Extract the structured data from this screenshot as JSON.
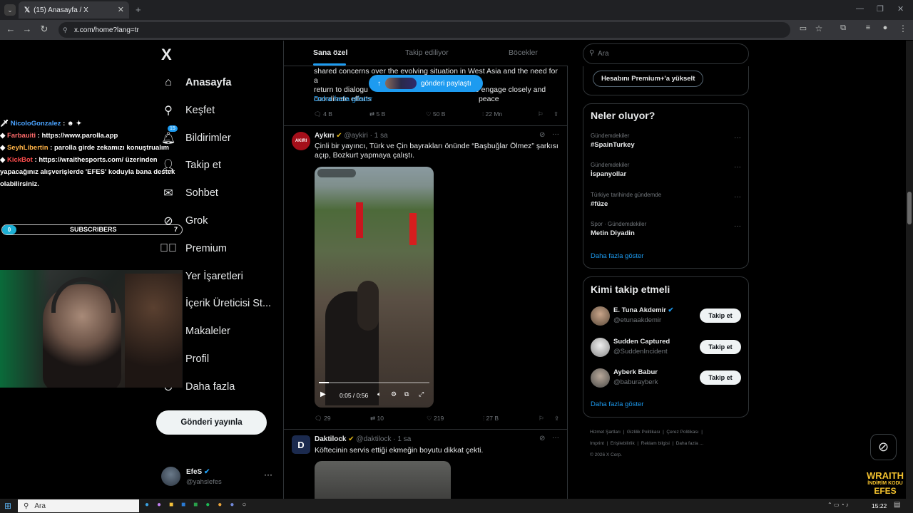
{
  "browser": {
    "tab_title": "(15) Anasayfa / X",
    "url": "x.com/home?lang=tr"
  },
  "nav": {
    "logo": "X",
    "items": [
      {
        "label": "Anasayfa",
        "icon": "home-icon"
      },
      {
        "label": "Keşfet",
        "icon": "search-icon"
      },
      {
        "label": "Bildirimler",
        "icon": "bell-icon",
        "badge": "15"
      },
      {
        "label": "Takip et",
        "icon": "follow-icon"
      },
      {
        "label": "Sohbet",
        "icon": "mail-icon"
      },
      {
        "label": "Grok",
        "icon": "grok-icon"
      },
      {
        "label": "Premium",
        "icon": "premium-icon"
      },
      {
        "label": "Yer İşaretleri",
        "icon": "bookmark-icon"
      },
      {
        "label": "İçerik Üreticisi St...",
        "icon": "studio-icon"
      },
      {
        "label": "Makaleler",
        "icon": "article-icon"
      },
      {
        "label": "Profil",
        "icon": "profile-icon"
      },
      {
        "label": "Daha fazla",
        "icon": "more-icon"
      }
    ],
    "post_button": "Gönderi yayınla",
    "account": {
      "name": "EfeS",
      "handle": "@yahslefes"
    }
  },
  "timeline": {
    "tabs": [
      "Sana özel",
      "Takip ediliyor",
      "Böcekler"
    ],
    "toast": "gönderi paylaştı",
    "prev_tweet": {
      "lines": [
        "shared concerns over the evolving situation in West Asia and the need for a",
        "return to dialogu",
        "o engage closely and",
        "coordinate efforts",
        "peace"
      ],
      "show_more": "Daha fazla göster",
      "replies": "4 B",
      "reposts": "5 B",
      "likes": "50 B",
      "views": "22 Mn"
    },
    "tweet1": {
      "avatar_text": "AKIRI",
      "name": "Aykırı",
      "handle": "@aykiri",
      "time": "· 1 sa",
      "text": "Çinli bir yayıncı, Türk ve Çin bayrakları önünde “Başbuğlar Ölmez” şarkısı açıp, Bozkurt yapmaya çalıştı.",
      "video_time": "0:05 / 0:56",
      "video_progress": 0.09,
      "replies": "29",
      "reposts": "10",
      "likes": "219",
      "views": "27 B"
    },
    "tweet2": {
      "avatar_text": "D",
      "name": "Daktilock",
      "handle": "@daktilock",
      "time": "· 1 sa",
      "text": "Köftecinin servis ettiği ekmeğin boyutu dikkat çekti."
    }
  },
  "sidebar": {
    "search_placeholder": "Ara",
    "premium_button": "Hesabını Premium+'a yükselt",
    "trends_title": "Neler oluyor?",
    "trends": [
      {
        "category": "Gündemdekiler",
        "name": "#SpainTurkey"
      },
      {
        "category": "Gündemdekiler",
        "name": "İspanyollar"
      },
      {
        "category": "Türkiye tarihinde gündemde",
        "name": "#füze"
      },
      {
        "category": "Spor · Gündemdekiler",
        "name": "Metin Diyadin"
      }
    ],
    "show_more": "Daha fazla göster",
    "follow_title": "Kimi takip etmeli",
    "follow": [
      {
        "name": "E. Tuna Akdemir",
        "handle": "@etunaakdemir",
        "button": "Takip et"
      },
      {
        "name": "Sudden Captured",
        "handle": "@SuddenIncident",
        "button": "Takip et"
      },
      {
        "name": "Ayberk Babur",
        "handle": "@baburayberk",
        "button": "Takip et"
      }
    ],
    "follow_more": "Daha fazla göster",
    "footer": [
      "Hizmet Şartları",
      "Gizlilik Politikası",
      "Çerez Politikası",
      "Imprint",
      "Erişilebilirlik",
      "Reklam bilgisi",
      "Daha fazla ...",
      "© 2026 X Corp."
    ]
  },
  "stream": {
    "chat": [
      {
        "user": "NicoloGonzalez",
        "user_color": "#4aa3ff",
        "msg": ""
      },
      {
        "user": "Farbauiti",
        "user_color": "#ff6b6b",
        "msg": "https://www.parolla.app"
      },
      {
        "user": "SeyhLibertin",
        "user_color": "#ffb347",
        "msg": "parolla girde zekamızı konuştrualım"
      },
      {
        "user": "KickBot",
        "user_color": "#ff4d4d",
        "msg": "https://wraithesports.com/ üzerinden yapacağınız alışverişlerde 'EFES' koduyla bana destek olabilirsiniz."
      }
    ],
    "sub_left": "0",
    "sub_label": "SUBSCRIBERS",
    "sub_right": "7",
    "sub_progress": 0.0,
    "brand_top": "WRAITH",
    "brand_mid": "İNDİRİM KODU",
    "brand_bottom": "EFES"
  },
  "taskbar": {
    "search": "Ara",
    "time": "15:22"
  }
}
